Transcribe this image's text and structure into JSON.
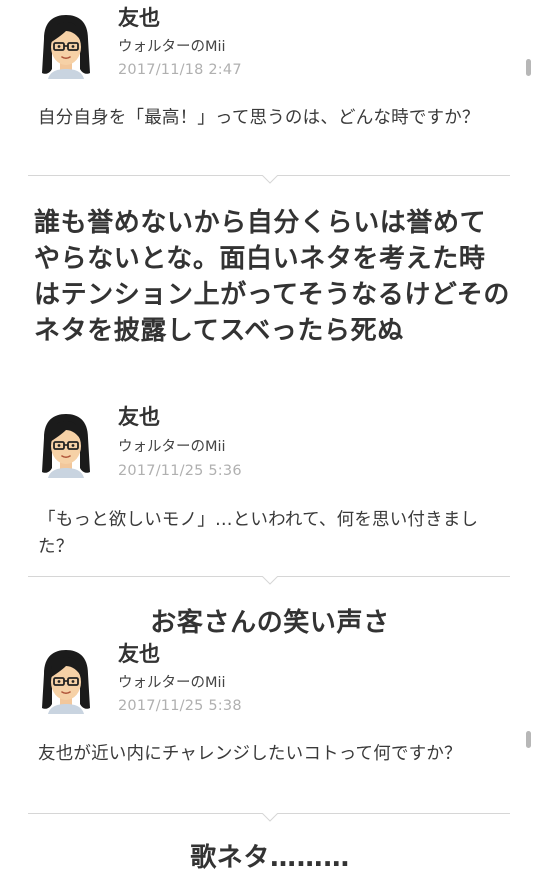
{
  "posts": [
    {
      "author_name": "友也",
      "author_mii": "ウォルターのMii",
      "timestamp": "2017/11/18  2:47",
      "question": "自分自身を「最高！」って思うのは、どんな時ですか？",
      "answer": "誰も誉めないから自分くらいは誉めてやらないとな。面白いネタを考えた時はテンション上がってそうなるけどそのネタを披露してスベったら死ぬ"
    },
    {
      "author_name": "友也",
      "author_mii": "ウォルターのMii",
      "timestamp": "2017/11/25  5:36",
      "question": "「もっと欲しいモノ」…といわれて、何を思い付きました？",
      "answer": "お客さんの笑い声さ"
    },
    {
      "author_name": "友也",
      "author_mii": "ウォルターのMii",
      "timestamp": "2017/11/25  5:38",
      "question": "友也が近い内にチャレンジしたいコトって何ですか？",
      "answer": "歌ネタ………"
    }
  ],
  "icons": {
    "avatar": "mii-avatar-icon",
    "divider": "down-notch-icon"
  },
  "colors": {
    "text": "#333333",
    "timestamp": "#b0b0b0",
    "divider": "#d6d6d6",
    "scroll": "#b7b7b7"
  }
}
